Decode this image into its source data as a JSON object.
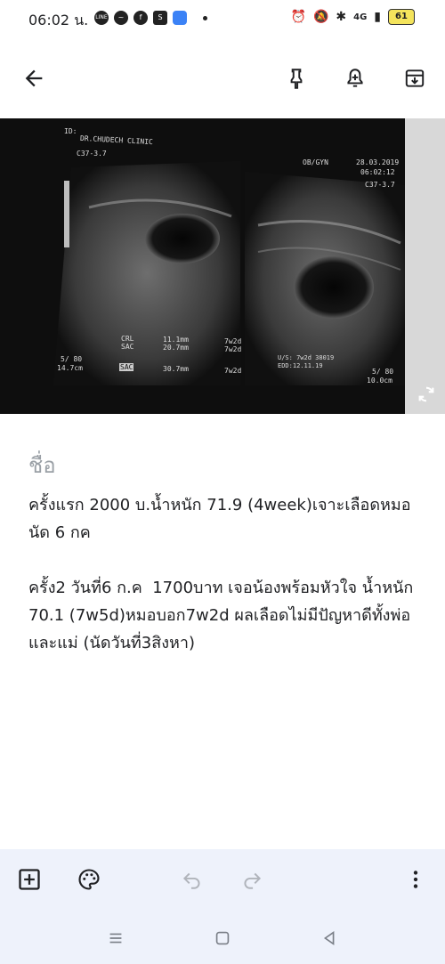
{
  "status": {
    "time": "06:02 น.",
    "notification_icons": [
      "line-icon",
      "messenger-icon",
      "facebook-icon",
      "shopee-icon",
      "app-icon"
    ],
    "network": "4G",
    "battery": "61"
  },
  "toolbar": {
    "back_icon": "arrow-left-icon",
    "pin_icon": "pin-icon",
    "reminder_icon": "bell-plus-icon",
    "archive_icon": "archive-icon"
  },
  "image": {
    "clinic": "DR.CHUDECH CLINIC",
    "id_label": "ID:",
    "probe": "C37-3.7",
    "mode": "OB/GYN",
    "date": "28.03.2019",
    "time": "06:02:12",
    "probe_right": "C37-3.7",
    "crl_label": "CRL",
    "sac_label": "SAC",
    "crl_value": "11.1mm",
    "sac_value": "20.7mm",
    "ga1": "7w2d",
    "ga2": "7w2d",
    "sac2_label": "SAC",
    "sac2_value": "30.7mm",
    "ga3": "7w2d",
    "depth_left": "5/ 80",
    "depth_left_cm": "14.7cm",
    "us_line": "U/S: 7w2d 38019",
    "edd_line": "EDD:12.11.19",
    "depth_right": "5/ 80",
    "depth_right_cm": "10.0cm"
  },
  "note": {
    "title_placeholder": "ชื่อ",
    "body": "ครั้งแรก 2000 บ.น้ำหนัก 71.9 (4week)เจาะเลือดหมอนัด 6 กค\n\nครั้ง2 วันที่6 ก.ค  1700บาท เจอน้องพร้อมหัวใจ น้ำหนัก 70.1 (7w5d)หมอบอก7w2d ผลเลือดไม่มีปัญหาดีทั้งพ่อและแม่ (นัดวันที่3สิงหา)"
  },
  "bottom_bar": {
    "add_icon": "add-box-icon",
    "palette_icon": "palette-icon",
    "undo_icon": "undo-icon",
    "redo_icon": "redo-icon",
    "more_icon": "more-vert-icon"
  },
  "nav": {
    "recents_icon": "recents-icon",
    "home_icon": "home-icon",
    "back_icon": "back-triangle-icon"
  }
}
